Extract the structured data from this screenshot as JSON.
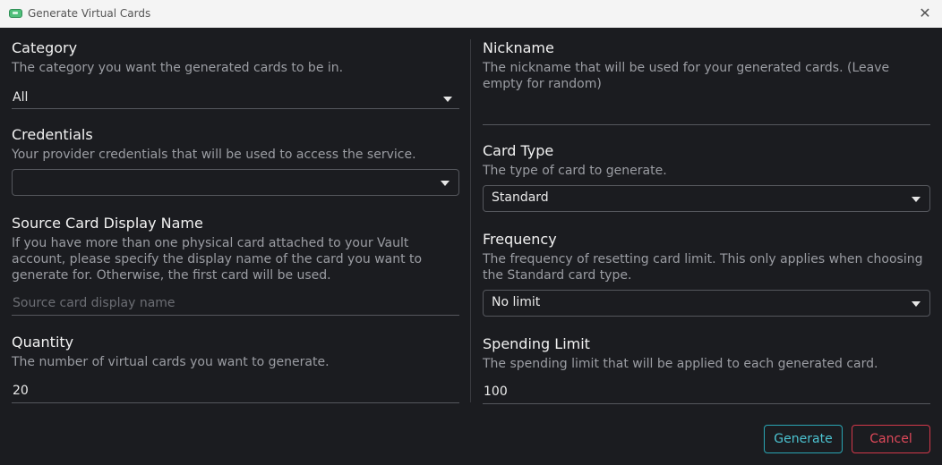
{
  "window": {
    "title": "Generate Virtual Cards"
  },
  "left": {
    "category": {
      "label": "Category",
      "description": "The category you want the generated cards to be in.",
      "value": "All"
    },
    "credentials": {
      "label": "Credentials",
      "description": "Your provider credentials that will be used to access the service.",
      "value": ""
    },
    "source_card": {
      "label": "Source Card Display Name",
      "description": "If you have more than one physical card attached to your Vault account, please specify the display name of the card you want to generate for. Otherwise, the first card will be used.",
      "placeholder": "Source card display name",
      "value": ""
    },
    "quantity": {
      "label": "Quantity",
      "description": "The number of virtual cards you want to generate.",
      "value": "20"
    }
  },
  "right": {
    "nickname": {
      "label": "Nickname",
      "description": "The nickname that will be used for your generated cards. (Leave empty for random)",
      "value": ""
    },
    "card_type": {
      "label": "Card Type",
      "description": "The type of card to generate.",
      "value": "Standard"
    },
    "frequency": {
      "label": "Frequency",
      "description": "The frequency of resetting card limit. This only applies when choosing the Standard card type.",
      "value": "No limit"
    },
    "spending_limit": {
      "label": "Spending Limit",
      "description": "The spending limit that will be applied to each generated card.",
      "value": "100"
    }
  },
  "actions": {
    "generate_label": "Generate",
    "cancel_label": "Cancel"
  },
  "colors": {
    "background": "#1b1c20",
    "generate_accent": "#2aa5b3",
    "cancel_accent": "#d2384a"
  }
}
